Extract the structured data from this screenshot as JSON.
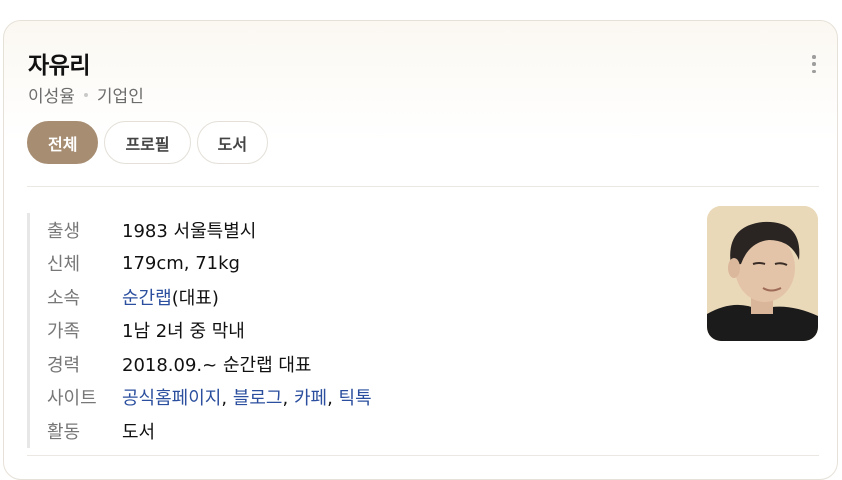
{
  "header": {
    "name": "자유리",
    "real_name": "이성율",
    "occupation": "기업인"
  },
  "tabs": [
    {
      "label": "전체",
      "active": true
    },
    {
      "label": "프로필",
      "active": false
    },
    {
      "label": "도서",
      "active": false
    }
  ],
  "info": {
    "birth": {
      "label": "출생",
      "value": "1983 서울특별시"
    },
    "body": {
      "label": "신체",
      "value": "179cm, 71kg"
    },
    "affiliation": {
      "label": "소속",
      "link": "순간랩",
      "suffix": "(대표)"
    },
    "family": {
      "label": "가족",
      "value": "1남 2녀 중 막내"
    },
    "career": {
      "label": "경력",
      "value": "2018.09.~ 순간랩 대표"
    },
    "sites": {
      "label": "사이트",
      "links": [
        "공식홈페이지",
        "블로그",
        "카페",
        "틱톡"
      ],
      "separator": ", "
    },
    "activity": {
      "label": "활동",
      "link": "도서"
    }
  },
  "colors": {
    "accent": "#a78d72",
    "link": "#2b4f9e",
    "photo_bg": "#ead9b9"
  },
  "icons": {
    "menu": "more-vertical-icon",
    "photo": "profile-photo"
  }
}
